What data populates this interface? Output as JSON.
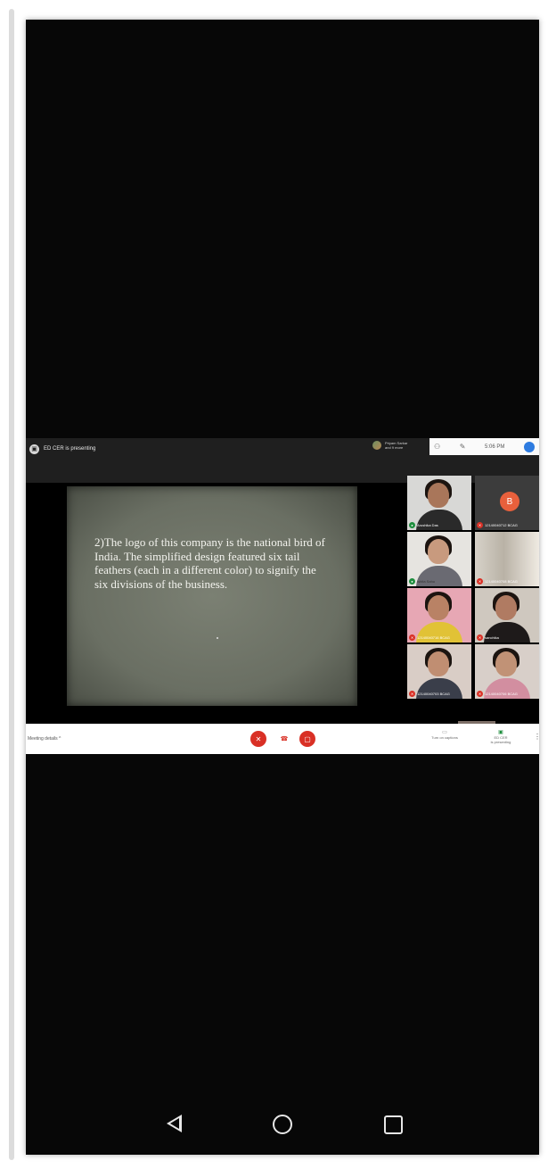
{
  "presenter_bar": {
    "status": "ED CER is presenting",
    "others_line1": "Priyam Sarkar",
    "others_line2": "and 9 more"
  },
  "statusbar": {
    "time": "5:06 PM"
  },
  "slide": {
    "text": "2)The logo of this company is the national bird of India. The simplified design featured six tail feathers (each in a different color) to signify the six divisions of the business."
  },
  "participants": [
    {
      "name": "Arushika Das"
    },
    {
      "name": "12140040712 BCAG",
      "avatar_letter": "B"
    },
    {
      "name": "Ishita Sahu"
    },
    {
      "name": "12140040708 BCAG"
    },
    {
      "name": "12140040716 BCAG"
    },
    {
      "name": "sanchika"
    },
    {
      "name": "12140040703 BCAG"
    },
    {
      "name": "12140040706 BCAG"
    }
  ],
  "controls": {
    "meeting_details": "Meeting details ^",
    "captions_label": "Turn on captions",
    "present_label_1": "ED CER",
    "present_label_2": "is presenting"
  },
  "icons": {
    "mic_off": "mic-off-icon",
    "end_call": "end-call-icon",
    "camera_off": "camera-off-icon",
    "nav_back": "triangle-left",
    "nav_home": "circle",
    "nav_recent": "square"
  },
  "colors": {
    "accent_red": "#d93025",
    "avatar_orange": "#e8603c",
    "present_green": "#1e8e3e"
  }
}
